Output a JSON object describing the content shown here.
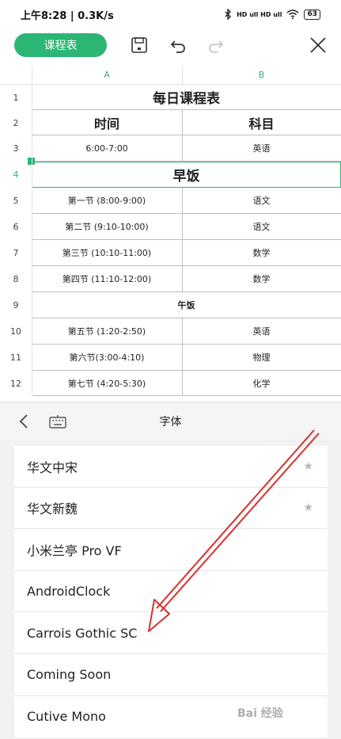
{
  "status_bar": {
    "time": "上午8:28 | 0.3K/s",
    "battery": "63",
    "signal": "HD ull HD ull"
  },
  "toolbar": {
    "schedule_button": "课程表"
  },
  "sheet": {
    "columns": [
      "A",
      "B"
    ],
    "title": "每日课程表",
    "header": {
      "a": "时间",
      "b": "科目"
    },
    "rows": [
      {
        "num": "3",
        "a": "6:00-7:00",
        "b": "英语"
      },
      {
        "num": "4",
        "merged": "早饭"
      },
      {
        "num": "5",
        "a": "第一节 (8:00-9:00)",
        "b": "语文"
      },
      {
        "num": "6",
        "a": "第二节 (9:10-10:00)",
        "b": "语文"
      },
      {
        "num": "7",
        "a": "第三节 (10:10-11:00)",
        "b": "数学"
      },
      {
        "num": "8",
        "a": "第四节 (11:10-12:00)",
        "b": "数学"
      },
      {
        "num": "9",
        "merged": "午饭"
      },
      {
        "num": "10",
        "a": "第五节 (1:20-2:50)",
        "b": "英语"
      },
      {
        "num": "11",
        "a": "第六节(3:00-4:10)",
        "b": "物理"
      },
      {
        "num": "12",
        "a": "第七节 (4:20-5:30)",
        "b": "化学"
      }
    ],
    "row_nums_top": [
      "1",
      "2"
    ]
  },
  "panel": {
    "title": "字体"
  },
  "fonts": [
    {
      "name": "华文中宋",
      "star": "★"
    },
    {
      "name": "华文新魏",
      "star": "★"
    },
    {
      "name": "小米兰亭 Pro VF"
    },
    {
      "name": "AndroidClock"
    },
    {
      "name": "Carrois Gothic SC"
    },
    {
      "name": "Coming Soon"
    },
    {
      "name": "Cutive Mono"
    }
  ],
  "watermark": "Bai 经验",
  "colors": {
    "accent": "#2bb673",
    "arrow": "#d9302c"
  }
}
